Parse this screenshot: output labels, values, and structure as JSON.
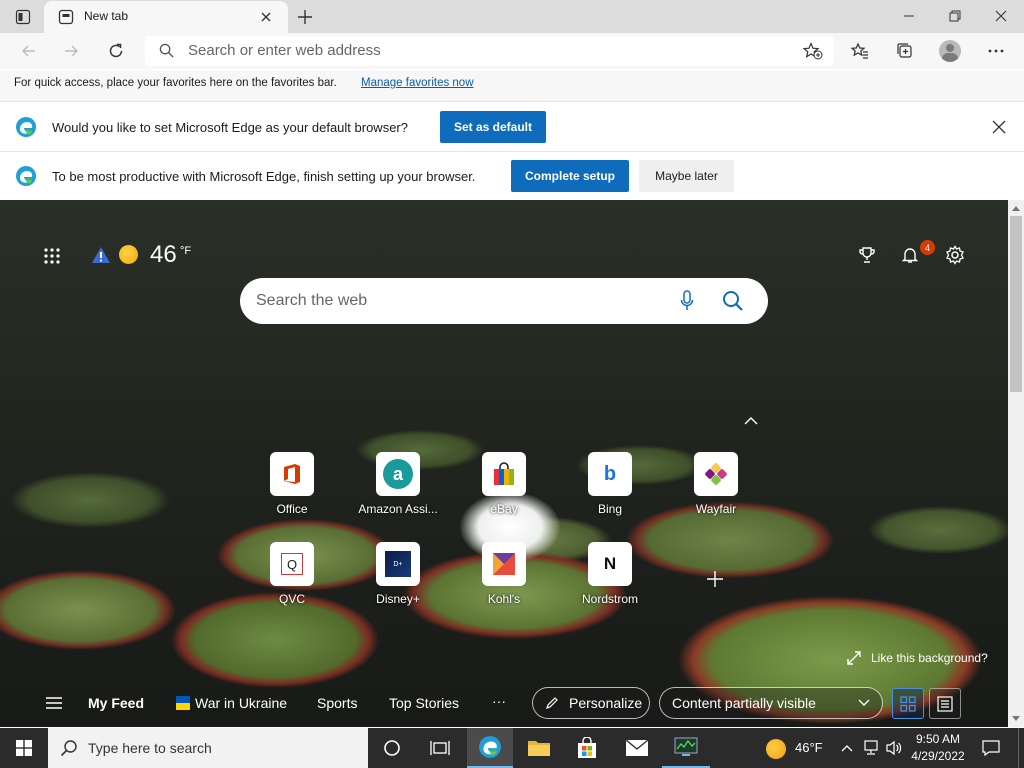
{
  "browser": {
    "tab_title": "New tab",
    "address_placeholder": "Search or enter web address"
  },
  "favorites_bar": {
    "message": "For quick access, place your favorites here on the favorites bar.",
    "link": "Manage favorites now"
  },
  "default_prompt": {
    "message": "Would you like to set Microsoft Edge as your default browser?",
    "button": "Set as default"
  },
  "setup_prompt": {
    "message": "To be most productive with Microsoft Edge, finish setting up your browser.",
    "primary_button": "Complete setup",
    "secondary_button": "Maybe later"
  },
  "newtab": {
    "weather_temp": "46",
    "weather_unit": "°F",
    "notification_count": "4",
    "search_placeholder": "Search the web",
    "tiles_row1": [
      "Office",
      "Amazon Assi...",
      "eBay",
      "Bing",
      "Wayfair"
    ],
    "tiles_row2": [
      "QVC",
      "Disney+",
      "Kohl's",
      "Nordstrom"
    ],
    "like_background": "Like this background?",
    "feed": {
      "my_feed": "My Feed",
      "war": "War in Ukraine",
      "sports": "Sports",
      "top_stories": "Top Stories",
      "more": "···",
      "personalize": "Personalize",
      "content_select": "Content partially visible"
    }
  },
  "taskbar": {
    "search_placeholder": "Type here to search",
    "tray_temp": "46°F",
    "time": "9:50 AM",
    "date": "4/29/2022"
  },
  "colors": {
    "accent_blue": "#0f6cbd",
    "title_bar": "#dcdcdc",
    "taskbar": "#2b2b2b",
    "badge": "#d83b01"
  }
}
